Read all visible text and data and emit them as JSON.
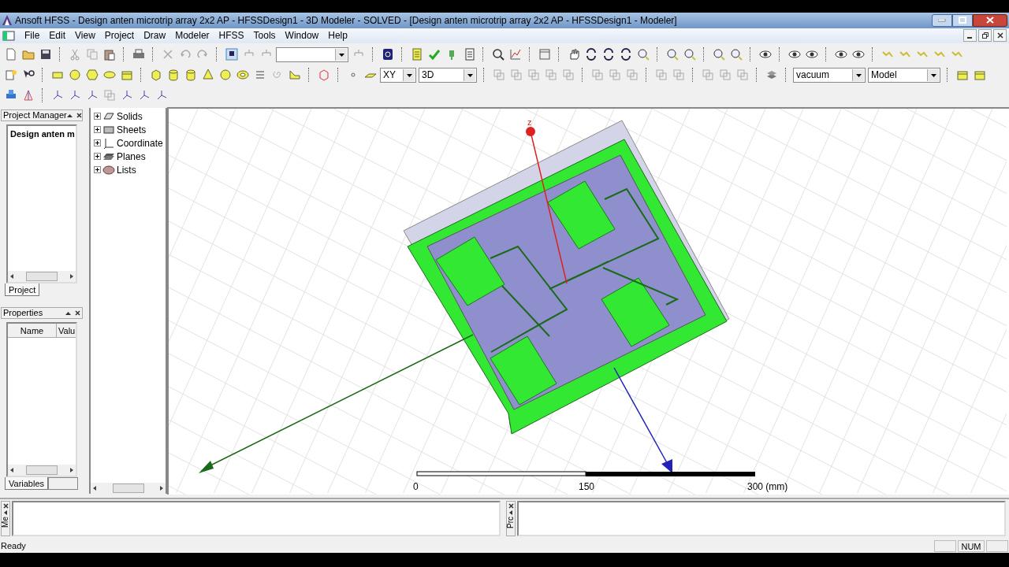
{
  "window": {
    "title": "Ansoft HFSS  - Design anten microtrip array 2x2 AP - HFSSDesign1 - 3D Modeler - SOLVED - [Design anten microtrip array 2x2 AP - HFSSDesign1 - Modeler]"
  },
  "menu": [
    "File",
    "Edit",
    "View",
    "Project",
    "Draw",
    "Modeler",
    "HFSS",
    "Tools",
    "Window",
    "Help"
  ],
  "toolbar": {
    "plane_dropdown": {
      "value": "XY"
    },
    "view_dropdown": {
      "value": "3D"
    },
    "material_dropdown": {
      "value": "vacuum"
    },
    "mode_dropdown": {
      "value": "Model"
    }
  },
  "project_manager": {
    "title": "Project Manager",
    "item": "Design anten m",
    "tab": "Project"
  },
  "properties": {
    "title": "Properties",
    "columns": [
      "Name",
      "Valu"
    ],
    "tab": "Variables"
  },
  "tree": [
    {
      "label": "Solids",
      "expanded": false,
      "kind": "solids"
    },
    {
      "label": "Sheets",
      "expanded": false,
      "kind": "sheets"
    },
    {
      "label": "Coordinate",
      "expanded": false,
      "kind": "coordinate"
    },
    {
      "label": "Planes",
      "expanded": false,
      "kind": "planes"
    },
    {
      "label": "Lists",
      "expanded": false,
      "kind": "lists"
    }
  ],
  "viewport": {
    "axis_label": "z",
    "scale": [
      "0",
      "150",
      "300 (mm)"
    ]
  },
  "message_panes": [
    {
      "tab": "Me"
    },
    {
      "tab": "Prc"
    }
  ],
  "status_bar": {
    "text": "Ready",
    "indicators": [
      "NUM"
    ]
  }
}
